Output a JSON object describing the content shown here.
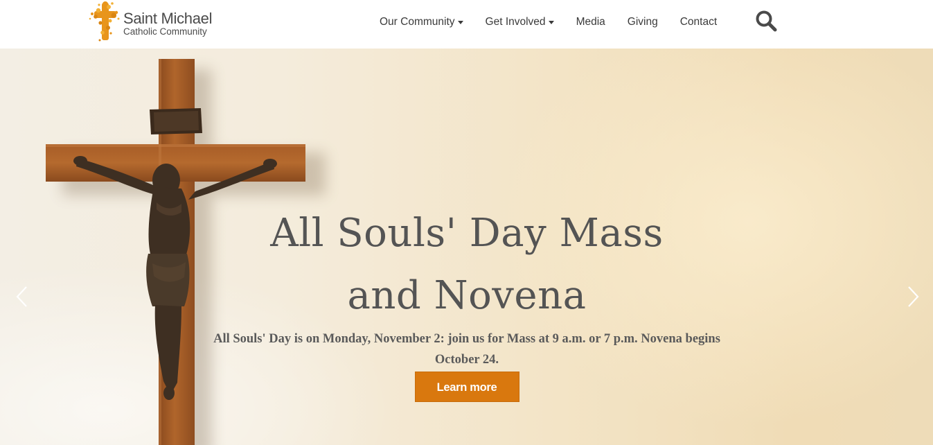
{
  "header": {
    "logo": {
      "name": "Saint Michael",
      "subtitle": "Catholic Community"
    },
    "nav": [
      {
        "label": "Our Community",
        "dropdown": true
      },
      {
        "label": "Get Involved",
        "dropdown": true
      },
      {
        "label": "Media",
        "dropdown": false
      },
      {
        "label": "Giving",
        "dropdown": false
      },
      {
        "label": "Contact",
        "dropdown": false
      }
    ],
    "search_icon": "search-icon"
  },
  "hero": {
    "title_line1": "All Souls' Day Mass",
    "title_line2": "and Novena",
    "text": "All Souls' Day is on Monday, November 2: join us for Mass at 9 a.m. or 7 p.m. Novena begins October 24.",
    "button_label": "Learn more",
    "prev_icon": "chevron-left-icon",
    "next_icon": "chevron-right-icon"
  },
  "colors": {
    "accent": "#d9780e",
    "logo_orange": "#e8951c",
    "text_dark": "#545454"
  }
}
